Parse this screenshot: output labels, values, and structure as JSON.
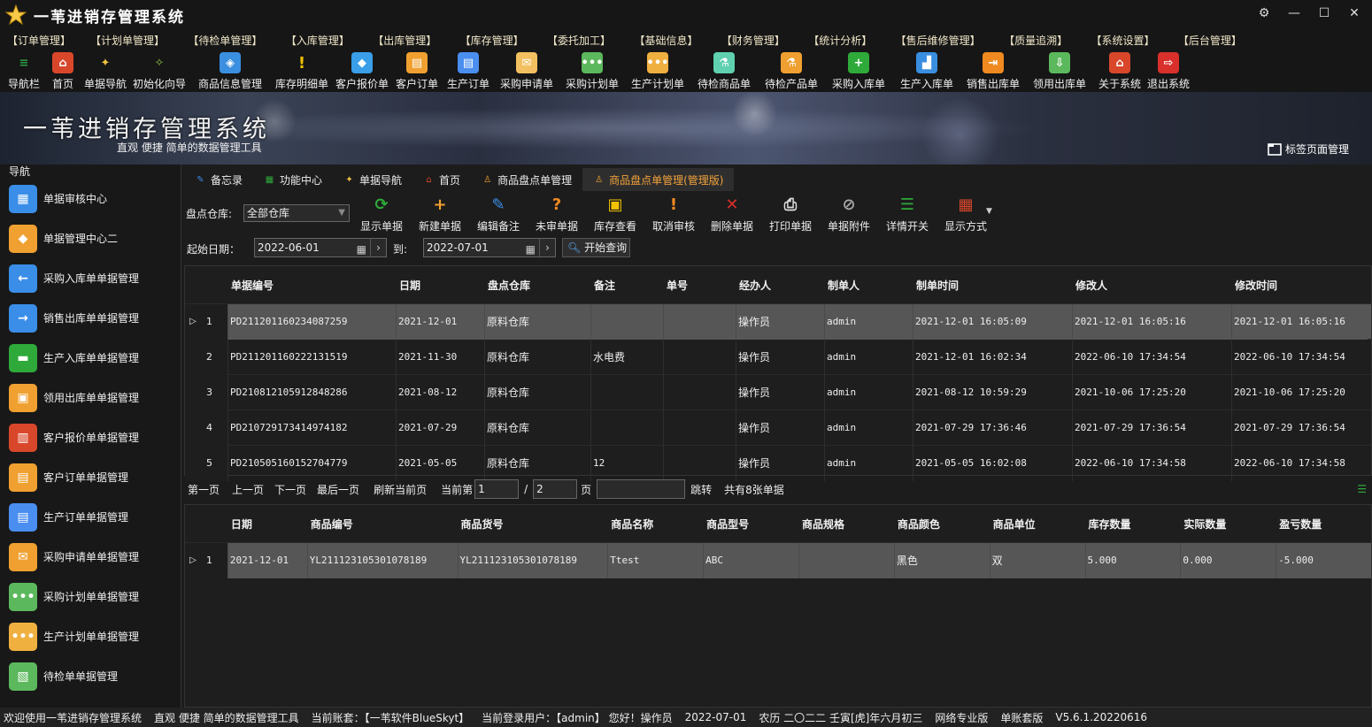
{
  "app": {
    "title": "一苇进销存管理系统"
  },
  "menu": [
    "【订单管理】",
    "【计划单管理】",
    "【待检单管理】",
    "【入库管理】",
    "【出库管理】",
    "【库存管理】",
    "【委托加工】",
    "【基础信息】",
    "【财务管理】",
    "【统计分析】",
    "【售后维修管理】",
    "【质量追溯】",
    "【系统设置】",
    "【后台管理】"
  ],
  "toolbar": [
    {
      "label": "导航栏",
      "icon": "menu-icon",
      "color": "#2f9e44"
    },
    {
      "label": "首页",
      "icon": "home-icon",
      "color": "#d9472b"
    },
    {
      "label": "单据导航",
      "icon": "wand-icon",
      "color": "#f0c040"
    },
    {
      "label": "初始化向导",
      "icon": "magic-wand-icon",
      "color": "#8fbf3f"
    },
    {
      "label": "商品信息管理",
      "icon": "cubes-icon",
      "color": "#3b8fe0"
    },
    {
      "label": "库存明细单",
      "icon": "warning-icon",
      "color": "#f2c200"
    },
    {
      "label": "客户报价单",
      "icon": "tag-icon",
      "color": "#3a9ee8"
    },
    {
      "label": "客户订单",
      "icon": "order-icon",
      "color": "#f0a030"
    },
    {
      "label": "生产订单",
      "icon": "production-order-icon",
      "color": "#4a8ef0"
    },
    {
      "label": "采购申请单",
      "icon": "request-icon",
      "color": "#f2c060"
    },
    {
      "label": "采购计划单",
      "icon": "chat-icon",
      "color": "#5cb85c"
    },
    {
      "label": "生产计划单",
      "icon": "chat-icon",
      "color": "#f0b040"
    },
    {
      "label": "待检商品单",
      "icon": "flask-icon",
      "color": "#5fd0b0"
    },
    {
      "label": "待检产品单",
      "icon": "flask-icon",
      "color": "#f0a030"
    },
    {
      "label": "采购入库单",
      "icon": "plus-icon",
      "color": "#2faa3a"
    },
    {
      "label": "生产入库单",
      "icon": "forklift-icon",
      "color": "#3a8ee0"
    },
    {
      "label": "销售出库单",
      "icon": "outbound-icon",
      "color": "#f08a20"
    },
    {
      "label": "领用出库单",
      "icon": "download-icon",
      "color": "#5cb85c"
    },
    {
      "label": "关于系统",
      "icon": "home-icon",
      "color": "#d9472b"
    },
    {
      "label": "退出系统",
      "icon": "exit-icon",
      "color": "#d9302b"
    }
  ],
  "banner": {
    "title": "一苇进销存管理系统",
    "subtitle": "直观 便捷 简单的数据管理工具",
    "tag_manage": "标签页面管理"
  },
  "sidebar": {
    "header": "导航",
    "items": [
      {
        "label": "单据审核中心",
        "icon": "grid-icon",
        "color": "#3a8ee8"
      },
      {
        "label": "单据管理中心二",
        "icon": "diamond-grid-icon",
        "color": "#f0a030"
      },
      {
        "label": "采购入库单单据管理",
        "icon": "arrow-left-icon",
        "color": "#3a8ee8"
      },
      {
        "label": "销售出库单单据管理",
        "icon": "arrow-right-icon",
        "color": "#3a8ee8"
      },
      {
        "label": "生产入库单单据管理",
        "icon": "folder-icon",
        "color": "#2faa3a"
      },
      {
        "label": "领用出库单单据管理",
        "icon": "box-icon",
        "color": "#f0a030"
      },
      {
        "label": "客户报价单单据管理",
        "icon": "books-icon",
        "color": "#d9472b"
      },
      {
        "label": "客户订单单据管理",
        "icon": "order-icon",
        "color": "#f0a030"
      },
      {
        "label": "生产订单单据管理",
        "icon": "production-order-icon",
        "color": "#4a8ef0"
      },
      {
        "label": "采购申请单单据管理",
        "icon": "envelope-icon",
        "color": "#f0a030"
      },
      {
        "label": "采购计划单单据管理",
        "icon": "chat-icon",
        "color": "#5cb85c"
      },
      {
        "label": "生产计划单单据管理",
        "icon": "chat-icon",
        "color": "#f0b040"
      },
      {
        "label": "待检单单据管理",
        "icon": "clipboard-icon",
        "color": "#5cb85c"
      }
    ]
  },
  "tabs": [
    {
      "label": "备忘录",
      "icon": "memo-icon",
      "active": false
    },
    {
      "label": "功能中心",
      "icon": "function-icon",
      "active": false
    },
    {
      "label": "单据导航",
      "icon": "wand-icon",
      "active": false
    },
    {
      "label": "首页",
      "icon": "home-icon",
      "active": false
    },
    {
      "label": "商品盘点单管理",
      "icon": "user-icon",
      "active": false
    },
    {
      "label": "商品盘点单管理(管理版)",
      "icon": "user-icon",
      "active": true
    }
  ],
  "filter": {
    "warehouse_label": "盘点仓库:",
    "warehouse_value": "全部仓库",
    "actions": [
      {
        "label": "显示单据",
        "icon": "refresh-icon",
        "color": "#2faa3a",
        "glyph": "⟳"
      },
      {
        "label": "新建单据",
        "icon": "add-icon",
        "color": "#f0a030",
        "glyph": "+"
      },
      {
        "label": "编辑备注",
        "icon": "edit-icon",
        "color": "#3a8ee8",
        "glyph": "✎"
      },
      {
        "label": "未审单据",
        "icon": "question-icon",
        "color": "#f08a20",
        "glyph": "?"
      },
      {
        "label": "库存查看",
        "icon": "box-icon",
        "color": "#f2c200",
        "glyph": "▣"
      },
      {
        "label": "取消审核",
        "icon": "warning-icon",
        "color": "#f08a20",
        "glyph": "!"
      },
      {
        "label": "删除单据",
        "icon": "delete-icon",
        "color": "#d9302b",
        "glyph": "✕"
      },
      {
        "label": "打印单据",
        "icon": "printer-icon",
        "color": "#dddddd",
        "glyph": "⎙"
      },
      {
        "label": "单据附件",
        "icon": "paperclip-icon",
        "color": "#aaaaaa",
        "glyph": "⊘"
      },
      {
        "label": "详情开关",
        "icon": "list-icon",
        "color": "#2faa3a",
        "glyph": "☰"
      },
      {
        "label": "显示方式",
        "icon": "view-grid-icon",
        "color": "#d9472b",
        "glyph": "▦"
      }
    ],
    "start_label": "起始日期：",
    "start_value": "2022-06-01",
    "to_label": "到:",
    "end_value": "2022-07-01",
    "query_label": "开始查询"
  },
  "master": {
    "columns": [
      "单据编号",
      "日期",
      "盘点仓库",
      "备注",
      "单号",
      "经办人",
      "制单人",
      "制单时间",
      "修改人",
      "修改时间"
    ],
    "rows": [
      [
        "PD211201160234087259",
        "2021-12-01",
        "原料仓库",
        "",
        "",
        "操作员",
        "admin",
        "2021-12-01 16:05:09",
        "2021-12-01 16:05:16",
        "2021-12-01 16:05:16"
      ],
      [
        "PD211201160222131519",
        "2021-11-30",
        "原料仓库",
        "水电费",
        "",
        "操作员",
        "admin",
        "2021-12-01 16:02:34",
        "2022-06-10 17:34:54",
        "2022-06-10 17:34:54"
      ],
      [
        "PD210812105912848286",
        "2021-08-12",
        "原料仓库",
        "",
        "",
        "操作员",
        "admin",
        "2021-08-12 10:59:29",
        "2021-10-06 17:25:20",
        "2021-10-06 17:25:20"
      ],
      [
        "PD210729173414974182",
        "2021-07-29",
        "原料仓库",
        "",
        "",
        "操作员",
        "admin",
        "2021-07-29 17:36:46",
        "2021-07-29 17:36:54",
        "2021-07-29 17:36:54"
      ],
      [
        "PD210505160152704779",
        "2021-05-05",
        "原料仓库",
        "12",
        "",
        "操作员",
        "admin",
        "2021-05-05 16:02:08",
        "2022-06-10 17:34:58",
        "2022-06-10 17:34:58"
      ]
    ]
  },
  "pager": {
    "first": "第一页",
    "prev": "上一页",
    "next": "下一页",
    "last": "最后一页",
    "refresh": "刷新当前页",
    "current_label": "当前第",
    "current": "1",
    "slash": "/",
    "total": "2",
    "page_label": "页",
    "jump_value": "",
    "jump": "跳转",
    "count": "共有8张单据"
  },
  "detail": {
    "columns": [
      "日期",
      "商品编号",
      "商品货号",
      "商品名称",
      "商品型号",
      "商品规格",
      "商品颜色",
      "商品单位",
      "库存数量",
      "实际数量",
      "盈亏数量"
    ],
    "rows": [
      [
        "2021-12-01",
        "YL211123105301078189",
        "YL211123105301078189",
        "Ttest",
        "ABC",
        "",
        "黑色",
        "双",
        "5.000",
        "0.000",
        "-5.000"
      ]
    ]
  },
  "status": [
    "欢迎使用一苇进销存管理系统",
    "直观 便捷 简单的数据管理工具",
    "当前账套：【一苇软件BlueSkyt】",
    "当前登录用户：【admin】 您好！操作员",
    "2022-07-01",
    "农历 二〇二二 壬寅[虎]年六月初三",
    "网络专业版",
    "单账套版",
    "V5.6.1.20220616"
  ]
}
